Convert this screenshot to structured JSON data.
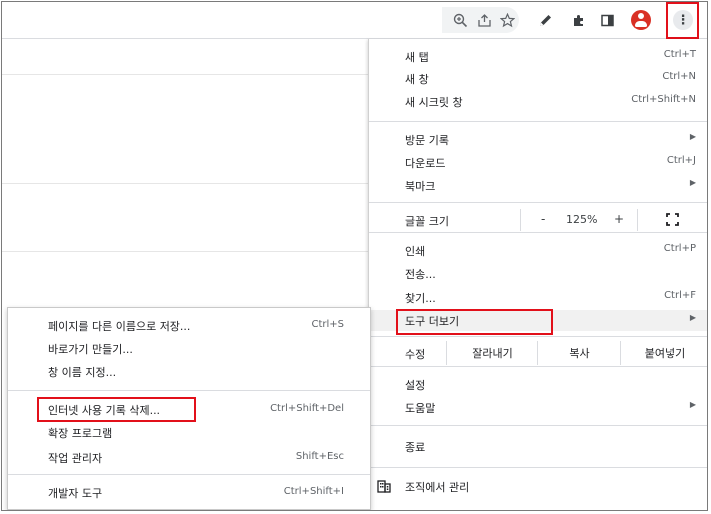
{
  "toolbar": {
    "icons": [
      "zoom-icon",
      "share-icon",
      "star-icon",
      "pencil-icon",
      "extensions-icon",
      "side-panel-icon",
      "profile-icon",
      "more-icon"
    ],
    "kebab_glyph": "⋮"
  },
  "menu": {
    "new_tab": {
      "label": "새 탭",
      "shortcut": "Ctrl+T"
    },
    "new_window": {
      "label": "새 창",
      "shortcut": "Ctrl+N"
    },
    "new_incognito": {
      "label": "새 시크릿 창",
      "shortcut": "Ctrl+Shift+N"
    },
    "history": {
      "label": "방문 기록"
    },
    "downloads": {
      "label": "다운로드",
      "shortcut": "Ctrl+J"
    },
    "bookmarks": {
      "label": "북마크"
    },
    "zoom": {
      "label": "글꼴 크기",
      "minus": "-",
      "value": "125%",
      "plus": "+"
    },
    "print": {
      "label": "인쇄",
      "shortcut": "Ctrl+P"
    },
    "cast": {
      "label": "전송..."
    },
    "find": {
      "label": "찾기...",
      "shortcut": "Ctrl+F"
    },
    "more_tools": {
      "label": "도구 더보기"
    },
    "edit": {
      "label": "수정",
      "cut": "잘라내기",
      "copy": "복사",
      "paste": "붙여넣기"
    },
    "settings": {
      "label": "설정"
    },
    "help": {
      "label": "도움말"
    },
    "exit": {
      "label": "종료"
    },
    "managed": {
      "label": "조직에서 관리"
    }
  },
  "submenu": {
    "save_page": {
      "label": "페이지를 다른 이름으로 저장...",
      "shortcut": "Ctrl+S"
    },
    "create_shortcut": {
      "label": "바로가기 만들기..."
    },
    "name_window": {
      "label": "창 이름 지정..."
    },
    "clear_data": {
      "label": "인터넷 사용 기록 삭제...",
      "shortcut": "Ctrl+Shift+Del"
    },
    "extensions": {
      "label": "확장 프로그램"
    },
    "task_manager": {
      "label": "작업 관리자",
      "shortcut": "Shift+Esc"
    },
    "dev_tools": {
      "label": "개발자 도구",
      "shortcut": "Ctrl+Shift+I"
    }
  },
  "colors": {
    "highlight": "#e2101a",
    "avatar": "#d93025"
  }
}
